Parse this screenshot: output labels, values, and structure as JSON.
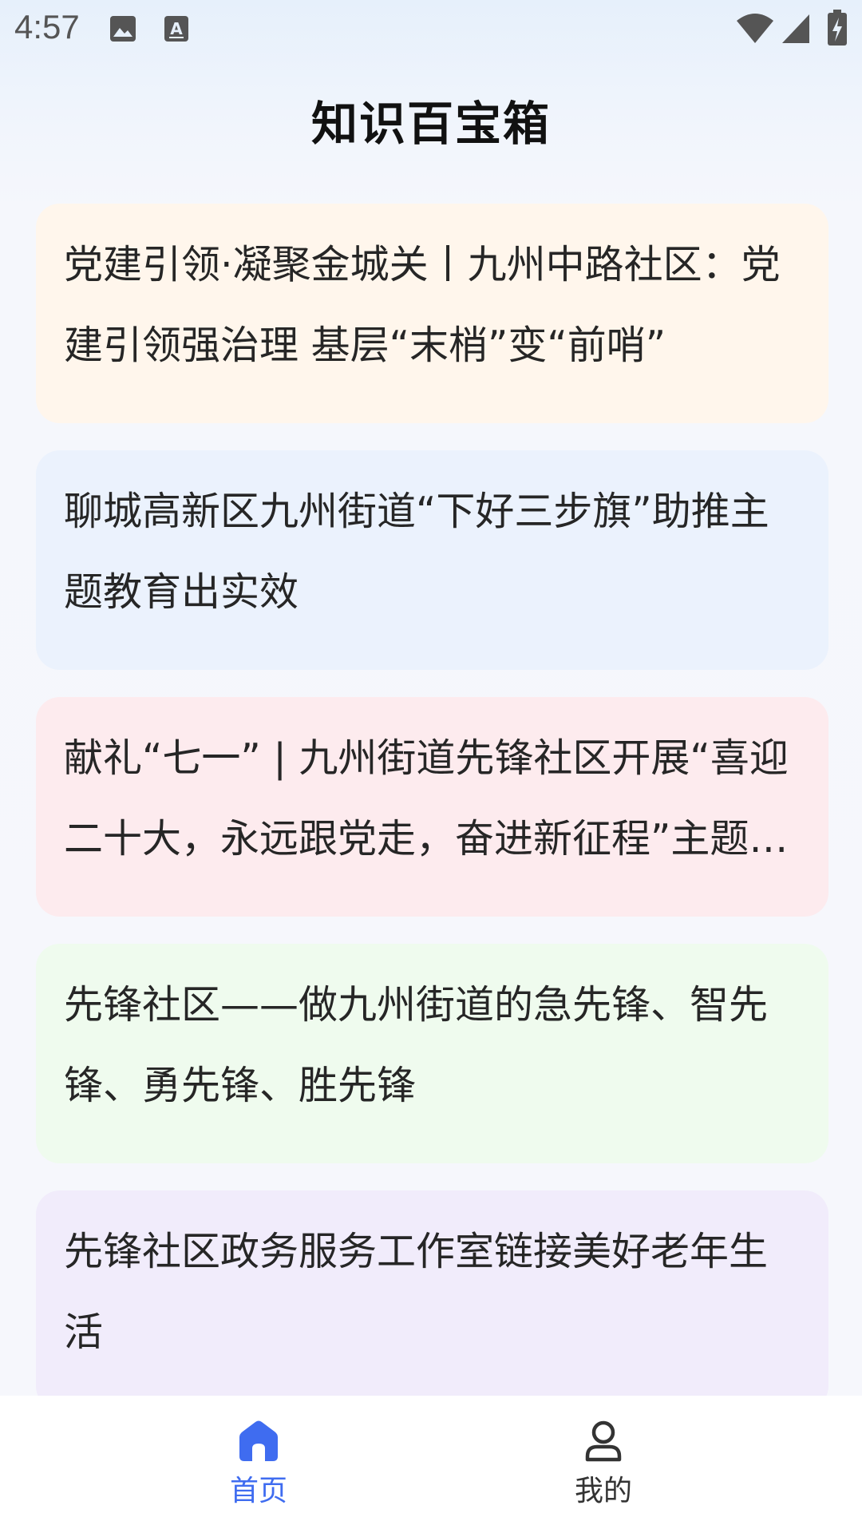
{
  "status_bar": {
    "time": "4:57",
    "icons": [
      "image-icon",
      "font-icon",
      "wifi-icon",
      "signal-icon",
      "battery-charging-icon"
    ]
  },
  "header": {
    "title": "知识百宝箱"
  },
  "articles": [
    {
      "title": "党建引领·凝聚金城关丨九州中路社区：党建引领强治理 基层“末梢”变“前哨”",
      "bg": "#fff6ec"
    },
    {
      "title": "聊城高新区九州街道“下好三步旗”助推主题教育出实效",
      "bg": "#ebf2fd"
    },
    {
      "title": "献礼“七一” | 九州街道先锋社区开展“喜迎二十大，永远跟党走，奋进新征程”主题活动",
      "bg": "#fdebee"
    },
    {
      "title": "先锋社区——做九州街道的急先锋、智先锋、勇先锋、胜先锋",
      "bg": "#effbee"
    },
    {
      "title": "先锋社区政务服务工作室链接美好老年生活",
      "bg": "#f1ecfb"
    }
  ],
  "bottom_nav": {
    "items": [
      {
        "label": "首页",
        "icon": "home-icon",
        "active": true,
        "color": "#3f6cf0"
      },
      {
        "label": "我的",
        "icon": "user-icon",
        "active": false,
        "color": "#333333"
      }
    ]
  }
}
